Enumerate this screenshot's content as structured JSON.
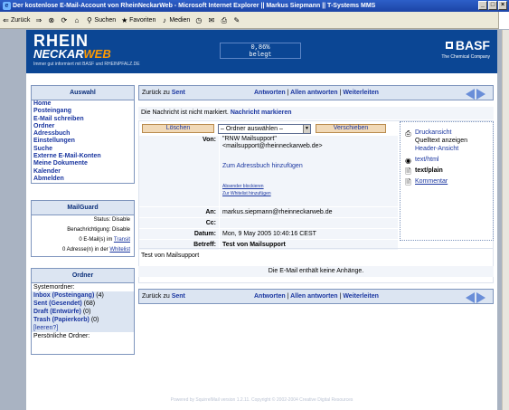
{
  "window": {
    "title": "Der kostenlose E-Mail-Account von RheinNeckarWeb - Microsoft Internet Explorer || Markus Siepmann || T-Systems MMS"
  },
  "toolbar": {
    "back": "Zurück",
    "search": "Suchen",
    "favorites": "Favoriten",
    "media": "Medien"
  },
  "banner": {
    "logo_rhein": "RHEIN",
    "logo_neckar": "NECKAR",
    "logo_web": "WEB",
    "tagline": "Immer gut informiert mit BASF und RHEINPFALZ.DE",
    "ticker_value": "0,86%",
    "ticker_label": "belegt",
    "basf_name": "BASF",
    "basf_claim": "The Chemical Company"
  },
  "sidebar": {
    "nav_title": "Auswahl",
    "nav_items": [
      "Home",
      "Posteingang",
      "E-Mail schreiben",
      "Ordner",
      "Adressbuch",
      "Einstellungen",
      "Suche",
      "Externe E-Mail-Konten",
      "Meine Dokumente",
      "Kalender",
      "Abmelden"
    ],
    "mailguard_title": "MailGuard",
    "mailguard": {
      "status": "Status: Disable",
      "notify": "Benachrichtigung: Disable",
      "transit_prefix": "0 E-Mail(s) im ",
      "transit_link": "Transit",
      "whitelist_prefix": "0 Adresse(n) in der ",
      "whitelist_link": "Whitelist"
    },
    "folders_title": "Ordner",
    "system_folders": "Systemordner:",
    "folders": [
      {
        "name": "Inbox (Posteingang)",
        "count": "(4)"
      },
      {
        "name": "Sent (Gesendet)",
        "count": "(68)"
      },
      {
        "name": "Draft (Entwürfe)",
        "count": "(0)"
      },
      {
        "name": "Trash (Papierkorb)",
        "count": "(0)"
      }
    ],
    "empty_trash": "[leeren?]",
    "personal_folders": "Persönliche Ordner:"
  },
  "message": {
    "back_prefix": "Zurück zu ",
    "back_link": "Sent",
    "reply": "Antworten",
    "reply_all": "Allen antworten",
    "forward": "Weiterleiten",
    "sep": "|",
    "not_marked": "Die Nachricht ist nicht markiert.",
    "mark_link": "Nachricht markieren",
    "delete_btn": "Löschen",
    "folder_select": "– Ordner auswählen –",
    "move_btn": "Verschieben",
    "from_label": "Von:",
    "from_name": "\"RNW Mailsupport\"",
    "from_addr": "<mailsupport@rheinneckarweb.de>",
    "add_contact": "Zum Adressbuch hinzufügen",
    "block_sender": "Absender blockieren",
    "add_whitelist": "Zur Whitelist hinzufügen",
    "to_label": "An:",
    "to_value": "markus.siepmann@rheinneckarweb.de",
    "cc_label": "Cc:",
    "cc_value": "",
    "date_label": "Datum:",
    "date_value": "Mon, 9 May 2005 10:40:16 CEST",
    "subject_label": "Betreff:",
    "subject_value": "Test von Mailsupport",
    "body": "Test von Mailsupport",
    "no_attachments": "Die E-Mail enthält keine Anhänge."
  },
  "sidepanel": {
    "print": "Druckansicht",
    "source": "Quelltext anzeigen",
    "header_view": "Header-Ansicht",
    "html": "text/html",
    "plain": "text/plain",
    "comment": "Kommentar"
  },
  "footer": "Powered by SquirrelMail version 1.2.11. Copyright © 2002-2004 Creative Digital Resources",
  "colors": {
    "banner": "#0b4694",
    "box_header": "#dce5f2",
    "link": "#1a36a0"
  }
}
